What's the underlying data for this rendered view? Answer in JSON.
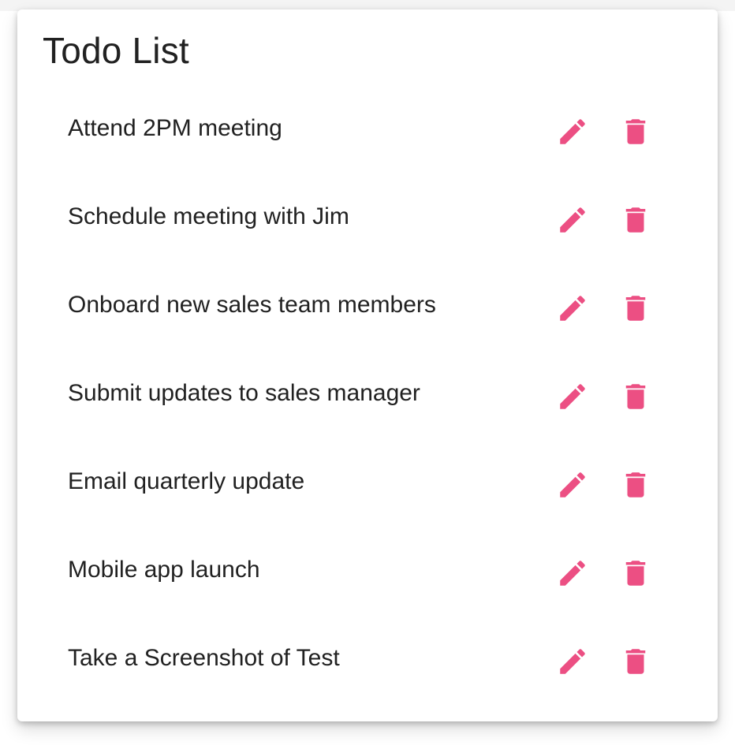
{
  "colors": {
    "accent": "#ec4f83",
    "text": "#212121"
  },
  "card": {
    "title": "Todo List"
  },
  "todos": [
    {
      "text": "Attend 2PM meeting",
      "edit_icon": "edit-icon",
      "delete_icon": "delete-icon"
    },
    {
      "text": "Schedule meeting with Jim",
      "edit_icon": "edit-icon",
      "delete_icon": "delete-icon"
    },
    {
      "text": "Onboard new sales team members",
      "edit_icon": "edit-icon",
      "delete_icon": "delete-icon"
    },
    {
      "text": "Submit updates to sales manager",
      "edit_icon": "edit-icon",
      "delete_icon": "delete-icon"
    },
    {
      "text": "Email quarterly update",
      "edit_icon": "edit-icon",
      "delete_icon": "delete-icon"
    },
    {
      "text": "Mobile app launch",
      "edit_icon": "edit-icon",
      "delete_icon": "delete-icon"
    },
    {
      "text": "Take a Screenshot of Test",
      "edit_icon": "edit-icon",
      "delete_icon": "delete-icon"
    }
  ]
}
